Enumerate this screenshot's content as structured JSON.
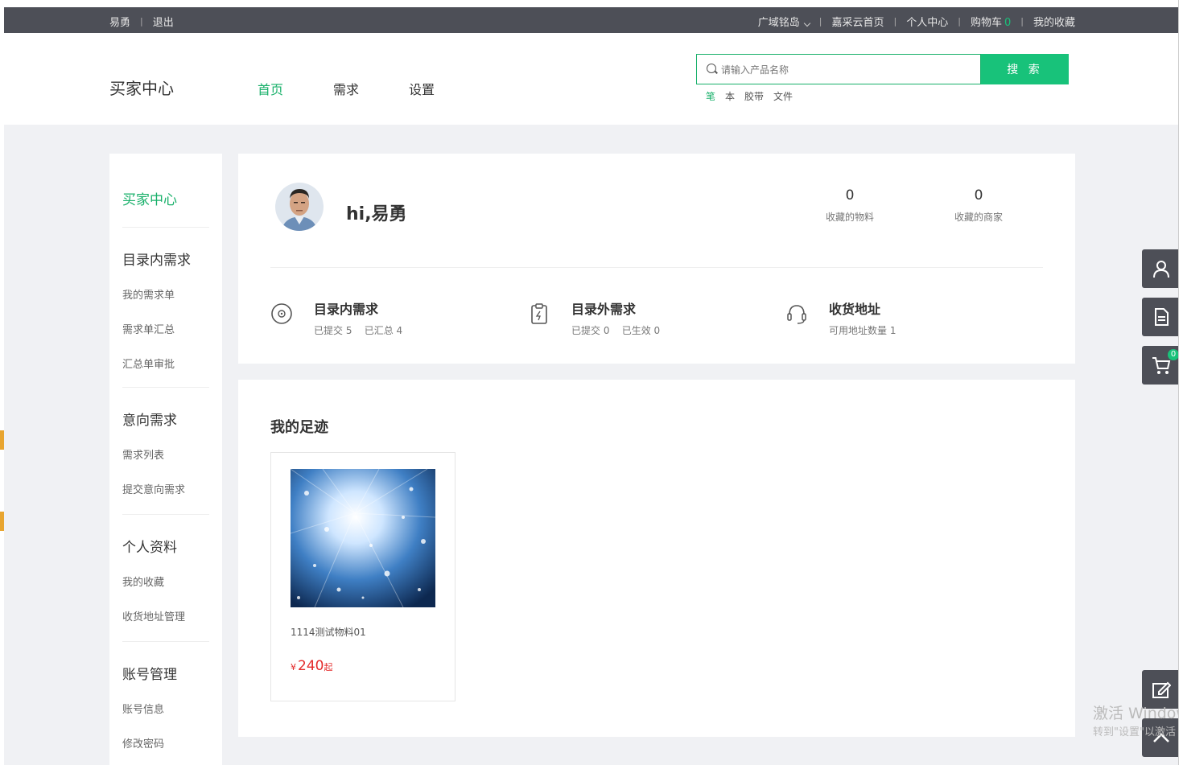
{
  "topbar": {
    "username": "易勇",
    "logout": "退出",
    "region": "广域铭岛",
    "home": "嘉采云首页",
    "personal_center": "个人中心",
    "cart_label": "购物车",
    "cart_count": "0",
    "favorites": "我的收藏"
  },
  "header": {
    "brand": "买家中心",
    "nav": [
      "首页",
      "需求",
      "设置"
    ],
    "search_placeholder": "请输入产品名称",
    "search_button": "搜 索",
    "hot_keywords": [
      "笔",
      "本",
      "胶带",
      "文件"
    ]
  },
  "sidebar": {
    "title": "买家中心",
    "groups": [
      {
        "title": "目录内需求",
        "items": [
          "我的需求单",
          "需求单汇总",
          "汇总单审批"
        ]
      },
      {
        "title": "意向需求",
        "items": [
          "需求列表",
          "提交意向需求"
        ]
      },
      {
        "title": "个人资料",
        "items": [
          "我的收藏",
          "收货地址管理"
        ]
      },
      {
        "title": "账号管理",
        "items": [
          "账号信息",
          "修改密码"
        ]
      }
    ]
  },
  "profile": {
    "greeting": "hi,易勇",
    "stats": [
      {
        "num": "0",
        "label": "收藏的物料"
      },
      {
        "num": "0",
        "label": "收藏的商家"
      }
    ],
    "quick": [
      {
        "title": "目录内需求",
        "sub": "已提交 5    已汇总 4",
        "icon": "target-icon"
      },
      {
        "title": "目录外需求",
        "sub": "已提交 0    已生效 0",
        "icon": "clipboard-icon"
      },
      {
        "title": "收货地址",
        "sub": "可用地址数量 1",
        "icon": "headset-icon"
      }
    ]
  },
  "footprint": {
    "title": "我的足迹",
    "items": [
      {
        "name": "1114测试物料01",
        "currency": "¥",
        "price": "240",
        "suffix": "起"
      }
    ]
  },
  "float": {
    "cart_badge": "0"
  },
  "watermark": {
    "line1": "激活 Windows",
    "line2": "转到\"设置\"以激活 Windows。"
  },
  "colors": {
    "accent": "#18c27a",
    "topbar": "#4d4f57",
    "price": "#e42a2a"
  }
}
